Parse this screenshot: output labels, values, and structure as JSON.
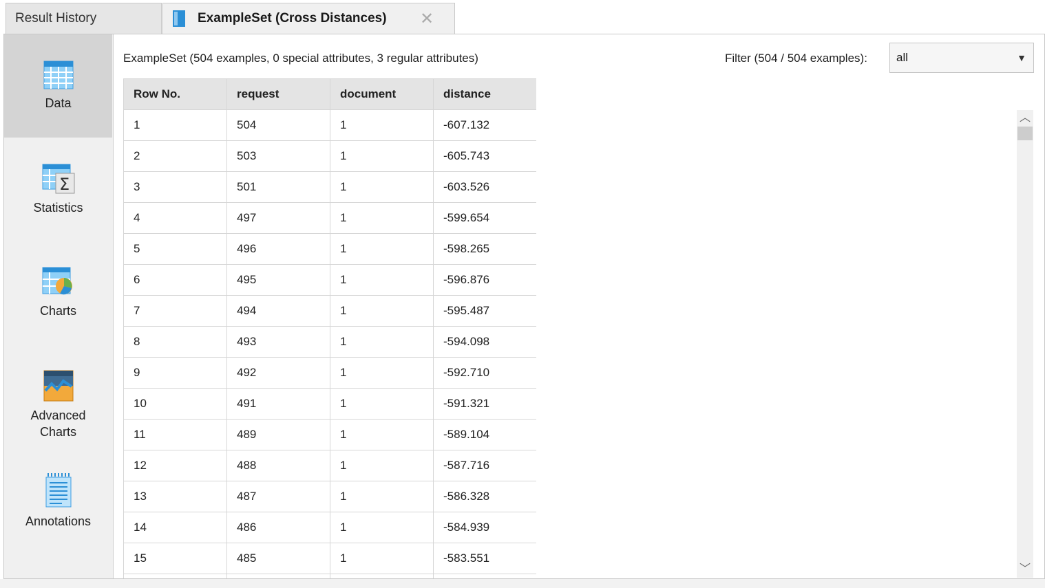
{
  "tabs": {
    "history_label": "Result History",
    "active_label": "ExampleSet (Cross Distances)",
    "close_symbol": "✕"
  },
  "sidebar": {
    "items": [
      {
        "label": "Data",
        "icon": "table-icon"
      },
      {
        "label": "Statistics",
        "icon": "statistics-icon"
      },
      {
        "label": "Charts",
        "icon": "chart-icon"
      },
      {
        "label": "Advanced Charts",
        "icon": "advanced-chart-icon"
      },
      {
        "label": "Annotations",
        "icon": "annotations-icon"
      }
    ]
  },
  "content": {
    "info": "ExampleSet (504 examples, 0 special attributes, 3 regular attributes)",
    "filter_label": "Filter (504 / 504 examples):",
    "filter_value": "all"
  },
  "table": {
    "columns": [
      "Row No.",
      "request",
      "document",
      "distance"
    ],
    "rows": [
      [
        "1",
        "504",
        "1",
        "-607.132"
      ],
      [
        "2",
        "503",
        "1",
        "-605.743"
      ],
      [
        "3",
        "501",
        "1",
        "-603.526"
      ],
      [
        "4",
        "497",
        "1",
        "-599.654"
      ],
      [
        "5",
        "496",
        "1",
        "-598.265"
      ],
      [
        "6",
        "495",
        "1",
        "-596.876"
      ],
      [
        "7",
        "494",
        "1",
        "-595.487"
      ],
      [
        "8",
        "493",
        "1",
        "-594.098"
      ],
      [
        "9",
        "492",
        "1",
        "-592.710"
      ],
      [
        "10",
        "491",
        "1",
        "-591.321"
      ],
      [
        "11",
        "489",
        "1",
        "-589.104"
      ],
      [
        "12",
        "488",
        "1",
        "-587.716"
      ],
      [
        "13",
        "487",
        "1",
        "-586.328"
      ],
      [
        "14",
        "486",
        "1",
        "-584.939"
      ],
      [
        "15",
        "485",
        "1",
        "-583.551"
      ],
      [
        "",
        "",
        "",
        ""
      ]
    ]
  },
  "colors": {
    "accent": "#2b8fd6",
    "sidebar_bg": "#f0f0f0",
    "selected_bg": "#d4d4d4"
  }
}
